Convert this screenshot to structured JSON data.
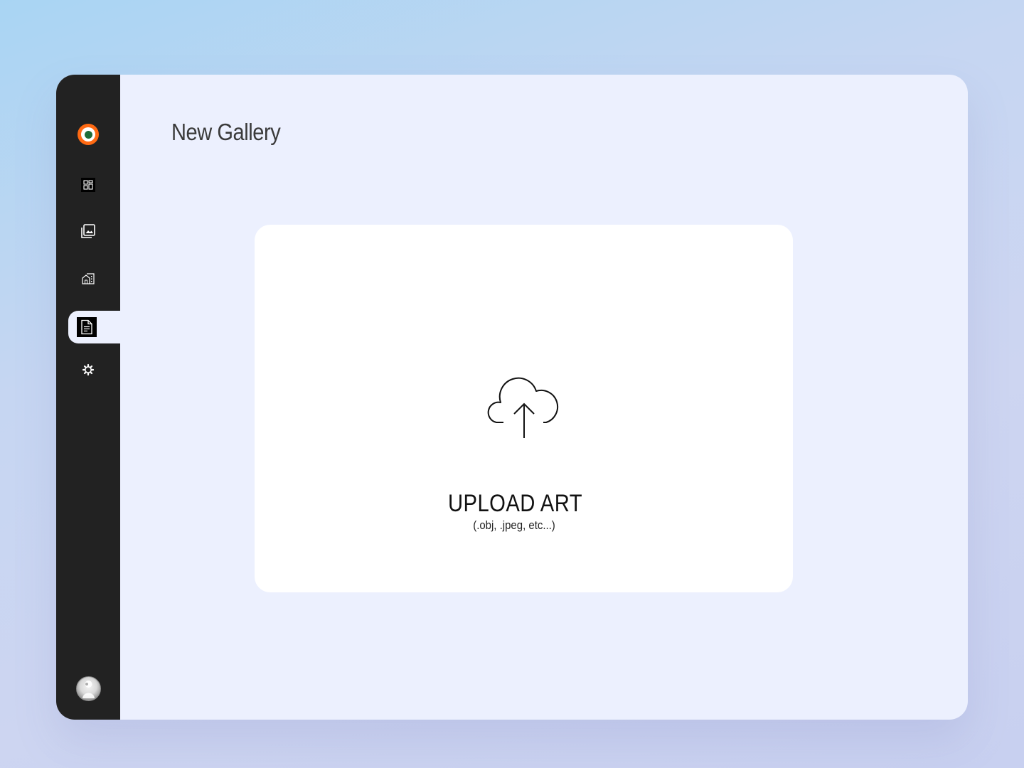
{
  "app": {
    "logo_icon": "orange-ring-logo-icon"
  },
  "sidebar": {
    "items": [
      {
        "name": "dashboard",
        "icon": "dashboard-grid-icon",
        "active": false
      },
      {
        "name": "gallery",
        "icon": "image-gallery-icon",
        "active": false
      },
      {
        "name": "buildings",
        "icon": "buildings-icon",
        "active": false
      },
      {
        "name": "documents",
        "icon": "document-icon",
        "active": true
      },
      {
        "name": "settings",
        "icon": "gear-icon",
        "active": false
      }
    ],
    "avatar_icon": "user-avatar"
  },
  "main": {
    "title": "New Gallery",
    "upload": {
      "icon": "cloud-upload-icon",
      "label": "UPLOAD ART",
      "hint": "(.obj, .jpeg, etc...)"
    }
  },
  "colors": {
    "sidebar_bg": "#222222",
    "content_bg": "#ecf0fe",
    "card_bg": "#ffffff",
    "accent_orange": "#ff6a13",
    "accent_green": "#1f6e3a"
  }
}
